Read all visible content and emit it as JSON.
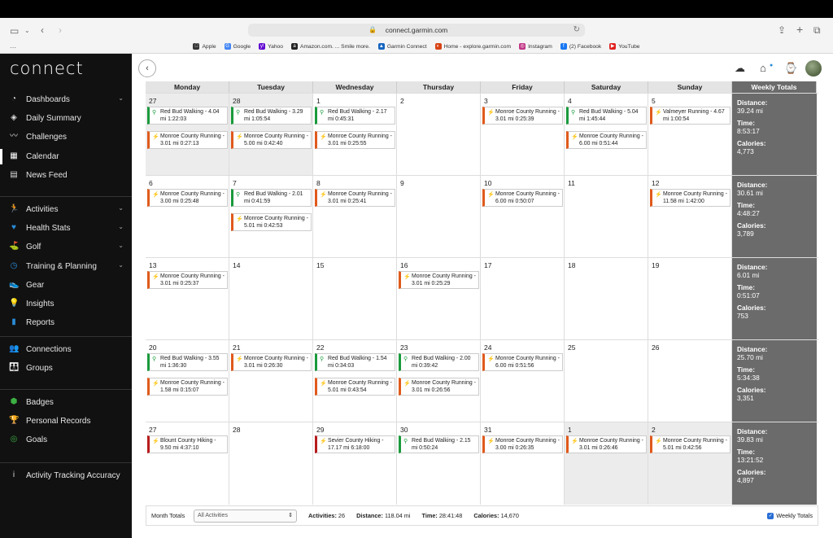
{
  "browser": {
    "url": "connect.garmin.com",
    "favorites": [
      {
        "label": "Apple",
        "icon": "apple-icon",
        "color": "#333333",
        "glyph": ""
      },
      {
        "label": "Google",
        "icon": "google-icon",
        "color": "#4285f4",
        "glyph": "G"
      },
      {
        "label": "Yahoo",
        "icon": "yahoo-icon",
        "color": "#6001d2",
        "glyph": "y!"
      },
      {
        "label": "Amazon.com. ... Smile more.",
        "icon": "amazon-icon",
        "color": "#222222",
        "glyph": "a"
      },
      {
        "label": "Garmin Connect",
        "icon": "garmin-icon",
        "color": "#1565c0",
        "glyph": "▲"
      },
      {
        "label": "Home - explore.garmin.com",
        "icon": "explore-icon",
        "color": "#d84315",
        "glyph": "◐"
      },
      {
        "label": "Instagram",
        "icon": "instagram-icon",
        "color": "#c13584",
        "glyph": "◎"
      },
      {
        "label": "(2) Facebook",
        "icon": "facebook-icon",
        "color": "#1877f2",
        "glyph": "f"
      },
      {
        "label": "YouTube",
        "icon": "youtube-icon",
        "color": "#e02020",
        "glyph": "▶"
      }
    ]
  },
  "sidebar": {
    "logo": "connect",
    "groups": [
      [
        {
          "label": "Dashboards",
          "icon": "gauge-icon",
          "glyph": "◔",
          "color": "#dddddd",
          "chevron": true
        },
        {
          "label": "Daily Summary",
          "icon": "layers-icon",
          "glyph": "◈",
          "color": "#dddddd",
          "chevron": false
        },
        {
          "label": "Challenges",
          "icon": "trend-icon",
          "glyph": "〰",
          "color": "#dddddd",
          "chevron": false
        },
        {
          "label": "Calendar",
          "icon": "calendar-icon",
          "glyph": "▦",
          "color": "#ffffff",
          "chevron": false,
          "active": true
        },
        {
          "label": "News Feed",
          "icon": "newsfeed-icon",
          "glyph": "▤",
          "color": "#dddddd",
          "chevron": false
        }
      ],
      [
        {
          "label": "Activities",
          "icon": "runner-icon",
          "glyph": "🏃",
          "color": "#2a8bd6",
          "chevron": true
        },
        {
          "label": "Health Stats",
          "icon": "heart-icon",
          "glyph": "♥",
          "color": "#2a8bd6",
          "chevron": true
        },
        {
          "label": "Golf",
          "icon": "golfer-icon",
          "glyph": "⛳",
          "color": "#2a8bd6",
          "chevron": true
        },
        {
          "label": "Training & Planning",
          "icon": "stopwatch-icon",
          "glyph": "◷",
          "color": "#2a8bd6",
          "chevron": true
        },
        {
          "label": "Gear",
          "icon": "shoe-icon",
          "glyph": "👟",
          "color": "#2a8bd6",
          "chevron": false
        },
        {
          "label": "Insights",
          "icon": "bulb-icon",
          "glyph": "💡",
          "color": "#2a8bd6",
          "chevron": false
        },
        {
          "label": "Reports",
          "icon": "bars-icon",
          "glyph": "▮",
          "color": "#2a8bd6",
          "chevron": false
        }
      ],
      [
        {
          "label": "Connections",
          "icon": "people-icon",
          "glyph": "👥",
          "color": "#e8891c",
          "chevron": false
        },
        {
          "label": "Groups",
          "icon": "group-icon",
          "glyph": "👪",
          "color": "#e8891c",
          "chevron": false
        }
      ],
      [
        {
          "label": "Badges",
          "icon": "badge-icon",
          "glyph": "⬢",
          "color": "#3cb043",
          "chevron": false
        },
        {
          "label": "Personal Records",
          "icon": "trophy-icon",
          "glyph": "🏆",
          "color": "#3cb043",
          "chevron": false
        },
        {
          "label": "Goals",
          "icon": "target-icon",
          "glyph": "◎",
          "color": "#3cb043",
          "chevron": false
        }
      ],
      [
        {
          "label": "Activity Tracking Accuracy",
          "icon": "info-icon",
          "glyph": "i",
          "color": "#dddddd",
          "chevron": false
        }
      ]
    ]
  },
  "calendar": {
    "headers": [
      "Monday",
      "Tuesday",
      "Wednesday",
      "Thursday",
      "Friday",
      "Saturday",
      "Sunday",
      "Weekly Totals"
    ],
    "total_labels": {
      "distance": "Distance:",
      "time": "Time:",
      "calories": "Calories:"
    },
    "weeks": [
      {
        "days": [
          {
            "num": "27",
            "other": true,
            "acts": [
              {
                "type": "walk",
                "text": "Red Bud Walking - 4.04 mi 1:22:03"
              },
              {
                "type": "run",
                "text": "Monroe County Running - 3.01 mi 0:27:13"
              }
            ]
          },
          {
            "num": "28",
            "other": true,
            "acts": [
              {
                "type": "walk",
                "text": "Red Bud Walking - 3.29 mi 1:05:54"
              },
              {
                "type": "run",
                "text": "Monroe County Running - 5.00 mi 0:42:40"
              }
            ]
          },
          {
            "num": "1",
            "acts": [
              {
                "type": "walk",
                "text": "Red Bud Walking - 2.17 mi 0:45:31"
              },
              {
                "type": "run",
                "text": "Monroe County Running - 3.01 mi 0:25:55"
              }
            ]
          },
          {
            "num": "2",
            "acts": []
          },
          {
            "num": "3",
            "acts": [
              {
                "type": "run",
                "text": "Monroe County Running - 3.01 mi 0:25:39"
              }
            ]
          },
          {
            "num": "4",
            "acts": [
              {
                "type": "walk",
                "text": "Red Bud Walking - 5.04 mi 1:45:44"
              },
              {
                "type": "run",
                "text": "Monroe County Running - 6.00 mi 0:51:44"
              }
            ]
          },
          {
            "num": "5",
            "acts": [
              {
                "type": "run",
                "text": "Valmeyer Running - 4.67 mi 1:00:54"
              }
            ]
          }
        ],
        "totals": {
          "distance": "39.24 mi",
          "time": "8:53:17",
          "calories": "4,773"
        }
      },
      {
        "days": [
          {
            "num": "6",
            "acts": [
              {
                "type": "run",
                "text": "Monroe County Running - 3.00 mi 0:25:48"
              }
            ]
          },
          {
            "num": "7",
            "acts": [
              {
                "type": "walk",
                "text": "Red Bud Walking - 2.01 mi 0:41:59"
              },
              {
                "type": "run",
                "text": "Monroe County Running - 5.01 mi 0:42:53"
              }
            ]
          },
          {
            "num": "8",
            "acts": [
              {
                "type": "run",
                "text": "Monroe County Running - 3.01 mi 0:25:41"
              }
            ]
          },
          {
            "num": "9",
            "acts": []
          },
          {
            "num": "10",
            "acts": [
              {
                "type": "run",
                "text": "Monroe County Running - 6.00 mi 0:50:07"
              }
            ]
          },
          {
            "num": "11",
            "acts": []
          },
          {
            "num": "12",
            "acts": [
              {
                "type": "run",
                "text": "Monroe County Running - 11.58 mi 1:42:00"
              }
            ]
          }
        ],
        "totals": {
          "distance": "30.61 mi",
          "time": "4:48:27",
          "calories": "3,789"
        }
      },
      {
        "days": [
          {
            "num": "13",
            "acts": [
              {
                "type": "run",
                "text": "Monroe County Running - 3.01 mi 0:25:37"
              }
            ]
          },
          {
            "num": "14",
            "acts": []
          },
          {
            "num": "15",
            "acts": []
          },
          {
            "num": "16",
            "acts": [
              {
                "type": "run",
                "text": "Monroe County Running - 3.01 mi 0:25:29"
              }
            ]
          },
          {
            "num": "17",
            "acts": []
          },
          {
            "num": "18",
            "acts": []
          },
          {
            "num": "19",
            "acts": []
          }
        ],
        "totals": {
          "distance": "6.01 mi",
          "time": "0:51:07",
          "calories": "753"
        }
      },
      {
        "days": [
          {
            "num": "20",
            "acts": [
              {
                "type": "walk",
                "text": "Red Bud Walking - 3.55 mi 1:36:30"
              },
              {
                "type": "run",
                "text": "Monroe County Running - 1.58 mi 0:15:07"
              }
            ]
          },
          {
            "num": "21",
            "acts": [
              {
                "type": "run",
                "text": "Monroe County Running - 3.01 mi 0:26:30"
              }
            ]
          },
          {
            "num": "22",
            "acts": [
              {
                "type": "walk",
                "text": "Red Bud Walking - 1.54 mi 0:34:03"
              },
              {
                "type": "run",
                "text": "Monroe County Running - 5.01 mi 0:43:54"
              }
            ]
          },
          {
            "num": "23",
            "acts": [
              {
                "type": "walk",
                "text": "Red Bud Walking - 2.00 mi 0:39:42"
              },
              {
                "type": "run",
                "text": "Monroe County Running - 3.01 mi 0:26:56"
              }
            ]
          },
          {
            "num": "24",
            "acts": [
              {
                "type": "run",
                "text": "Monroe County Running - 6.00 mi 0:51:56"
              }
            ]
          },
          {
            "num": "25",
            "acts": []
          },
          {
            "num": "26",
            "acts": []
          }
        ],
        "totals": {
          "distance": "25.70 mi",
          "time": "5:34:38",
          "calories": "3,351"
        }
      },
      {
        "days": [
          {
            "num": "27",
            "acts": [
              {
                "type": "hike",
                "text": "Blount County Hiking - 9.50 mi 4:37:10"
              }
            ]
          },
          {
            "num": "28",
            "acts": []
          },
          {
            "num": "29",
            "acts": [
              {
                "type": "hike",
                "text": "Sevier County Hiking - 17.17 mi 6:18:00"
              }
            ]
          },
          {
            "num": "30",
            "acts": [
              {
                "type": "walk",
                "text": "Red Bud Walking - 2.15 mi 0:50:24"
              }
            ]
          },
          {
            "num": "31",
            "acts": [
              {
                "type": "run",
                "text": "Monroe County Running - 3.00 mi 0:26:35"
              }
            ]
          },
          {
            "num": "1",
            "other": true,
            "acts": [
              {
                "type": "run",
                "text": "Monroe County Running - 3.01 mi 0:26:46"
              }
            ]
          },
          {
            "num": "2",
            "other": true,
            "acts": [
              {
                "type": "run",
                "text": "Monroe County Running - 5.01 mi 0:42:56"
              }
            ]
          }
        ],
        "totals": {
          "distance": "39.83 mi",
          "time": "13:21:52",
          "calories": "4,897"
        }
      }
    ]
  },
  "footer": {
    "month_totals_label": "Month Totals",
    "filter_value": "All Activities",
    "activities_label": "Activities:",
    "activities_value": "26",
    "distance_label": "Distance:",
    "distance_value": "118.04 mi",
    "time_label": "Time:",
    "time_value": "28:41:48",
    "calories_label": "Calories:",
    "calories_value": "14,670",
    "weekly_totals_label": "Weekly Totals"
  },
  "colors": {
    "run": "#e05a1c",
    "walk": "#1a9a3c",
    "hike": "#b71c1c",
    "totals_bg": "#6b6b6b"
  }
}
